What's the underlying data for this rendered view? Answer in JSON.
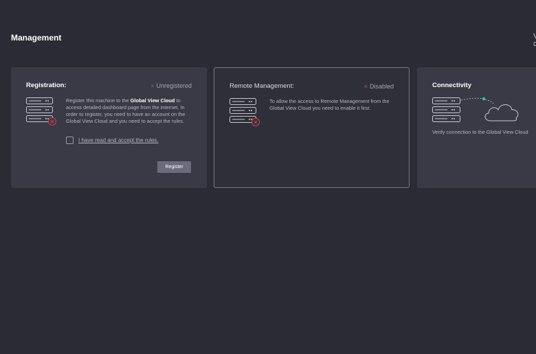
{
  "page": {
    "title": "Management",
    "edge_text": "V\nc"
  },
  "registration": {
    "title": "Registration:",
    "status": "Unregistered",
    "status_mark": "×",
    "desc_before": "Register this machine to the ",
    "desc_strong": "Global View Cloud",
    "desc_after": " to access detailed dashboard page from the internet. In order to register, you need to have an account on the Global View Cloud and you need to accept the rules.",
    "rules_label": "I have read and accept the rules.",
    "rules_checked": false,
    "register_label": "Register"
  },
  "remote": {
    "title": "Remote Management:",
    "status": "Disabled",
    "status_mark": "×",
    "desc": "To allow the access to Remote Management from the Global View Cloud you need to enable it first."
  },
  "connectivity": {
    "title": "Connectivity",
    "desc": "Verify connection to the Global View Cloud"
  },
  "icons": {
    "registration": "server-error-icon",
    "remote": "server-error-icon",
    "connectivity": "server-cloud-connection-icon"
  },
  "colors": {
    "background": "#2b2b36",
    "card": "#3a3a46",
    "error": "#d9414c",
    "connection_dot": "#2fc4a6",
    "button": "#6b6b7c"
  }
}
